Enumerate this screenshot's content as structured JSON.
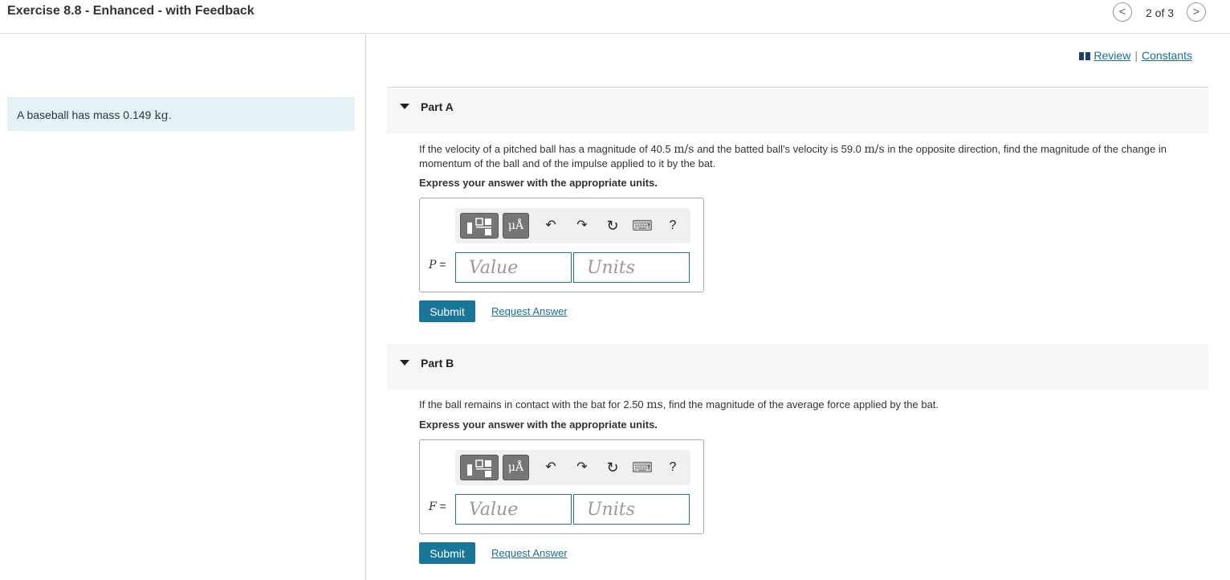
{
  "header": {
    "title": "Exercise 8.8 - Enhanced - with Feedback",
    "prev_label": "<",
    "next_label": ">",
    "position": "2 of 3"
  },
  "intro": {
    "text_before": "A baseball has mass 0.149 ",
    "unit": "kg",
    "text_after": "."
  },
  "links": {
    "review": "Review",
    "separator": "|",
    "constants": "Constants"
  },
  "parts": [
    {
      "label": "Part A",
      "question": {
        "t1": "If the velocity of a pitched ball has a magnitude of 40.5 ",
        "u1": "m/s",
        "t2": " and the batted ball's velocity is 59.0 ",
        "u2": "m/s",
        "t3": " in the opposite direction, find the magnitude of the change in momentum of the ball and of the impulse applied to it by the bat."
      },
      "express": "Express your answer with the appropriate units.",
      "toolbar": {
        "mu_label": "μÅ",
        "undo": "↶",
        "redo": "↷",
        "reset": "↻",
        "keyboard": "⌨",
        "help": "?"
      },
      "variable": "P",
      "equals": " =",
      "value_placeholder": "Value",
      "units_placeholder": "Units",
      "submit": "Submit",
      "request": "Request Answer"
    },
    {
      "label": "Part B",
      "question": {
        "t1": "If the ball remains in contact with the bat for 2.50 ",
        "u1": "ms",
        "t2": ", find the magnitude of the average force applied by the bat."
      },
      "express": "Express your answer with the appropriate units.",
      "toolbar": {
        "mu_label": "μÅ",
        "undo": "↶",
        "redo": "↷",
        "reset": "↻",
        "keyboard": "⌨",
        "help": "?"
      },
      "variable": "F",
      "equals": " =",
      "value_placeholder": "Value",
      "units_placeholder": "Units",
      "submit": "Submit",
      "request": "Request Answer"
    }
  ],
  "colors": {
    "accent": "#1a7698",
    "link": "#1a6e9b",
    "intro_bg": "#e6f3f6",
    "part_header_bg": "#f6f6f6"
  }
}
